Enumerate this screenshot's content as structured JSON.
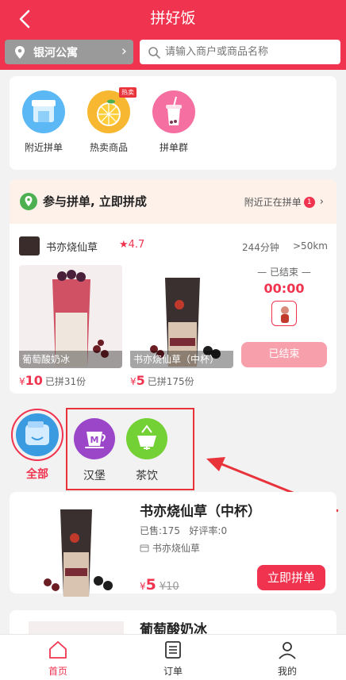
{
  "header": {
    "title": "拼好饭",
    "back_icon": "chevron-left-icon",
    "location": "银河公寓",
    "search_placeholder": "请输入商户或商品名称"
  },
  "quick_entries": [
    {
      "label": "附近拼单",
      "icon": "store-icon",
      "color": "#3fa9f5"
    },
    {
      "label": "热卖商品",
      "icon": "orange-icon",
      "color": "#f5a623",
      "tag": "热卖"
    },
    {
      "label": "拼单群",
      "icon": "bubble-tea-icon",
      "color": "#f06292"
    }
  ],
  "group_buy": {
    "title": "参与拼单, 立即拼成",
    "nearby_text": "附近正在拼单",
    "nearby_count": "1",
    "shop": {
      "name": "书亦烧仙草",
      "rating": "★4.7",
      "delivery_time": "244分钟",
      "distance": ">50km"
    },
    "products": [
      {
        "name": "葡萄酸奶冰",
        "price_symbol": "¥",
        "price": "10",
        "sold": "已拼31份"
      },
      {
        "name": "书亦烧仙草（中杯）",
        "price_symbol": "¥",
        "price": "5",
        "sold": "已拼175份"
      }
    ],
    "status_label": "已结束",
    "countdown": "00:00",
    "ended_button": "已结束"
  },
  "categories": [
    {
      "label": "全部",
      "active": true
    },
    {
      "label": "汉堡",
      "icon": "burger-cup-icon",
      "color": "#8e44ad"
    },
    {
      "label": "茶饮",
      "icon": "tea-cup-icon",
      "color": "#7ed321"
    }
  ],
  "product_list": [
    {
      "name": "书亦烧仙草（中杯）",
      "sold": "已售:175",
      "rating": "好评率:0",
      "shop": "书亦烧仙草",
      "price_symbol": "¥",
      "price": "5",
      "old_price": "¥10",
      "button": "立即拼单"
    },
    {
      "name": "葡萄酸奶冰"
    }
  ],
  "bottom_nav": [
    {
      "label": "首页",
      "icon": "home-icon",
      "active": true
    },
    {
      "label": "订单",
      "icon": "order-list-icon"
    },
    {
      "label": "我的",
      "icon": "user-icon"
    }
  ],
  "colors": {
    "brand": "#f0344f",
    "header_bg": "#f0344f",
    "page_bg": "#f2f2f2",
    "group_head_bg": "#fdf1ea"
  }
}
